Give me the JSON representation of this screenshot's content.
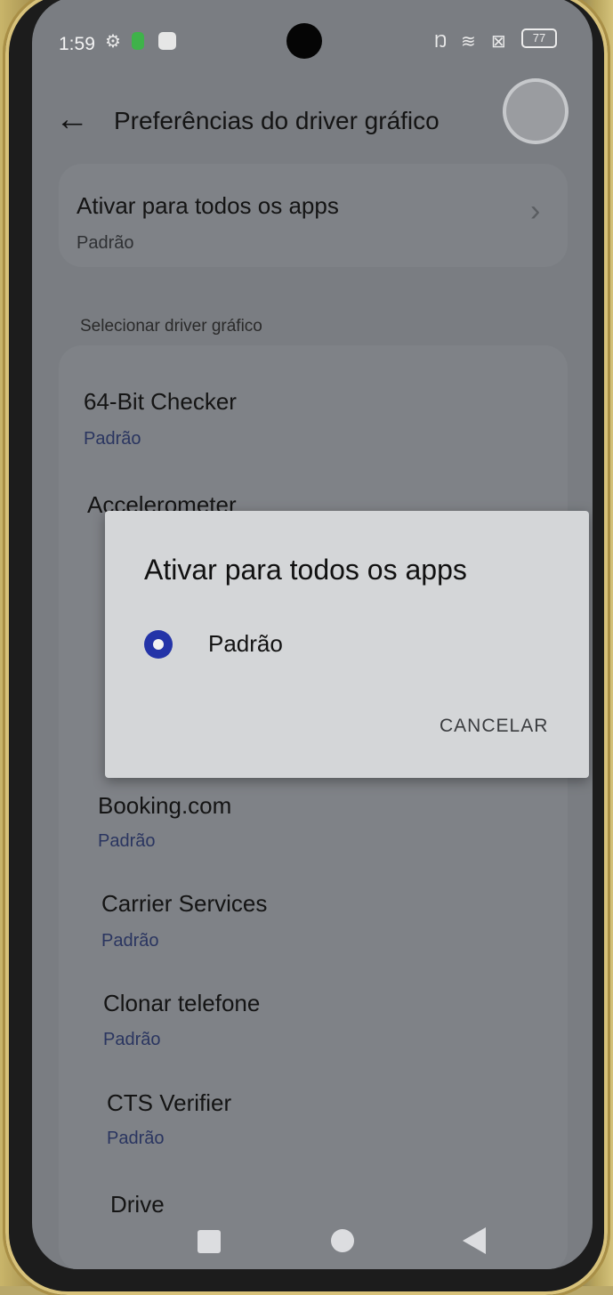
{
  "status_bar": {
    "time": "1:59",
    "battery": "77"
  },
  "header": {
    "title": "Preferências do driver gráfico"
  },
  "top_setting": {
    "title": "Ativar para todos os apps",
    "value": "Padrão"
  },
  "section_label": "Selecionar driver gráfico",
  "apps": [
    {
      "name": "64-Bit Checker",
      "value": "Padrão"
    },
    {
      "name": "Accelerometer",
      "value": ""
    },
    {
      "name": "Booking.com",
      "value": "Padrão"
    },
    {
      "name": "Carrier Services",
      "value": "Padrão"
    },
    {
      "name": "Clonar telefone",
      "value": "Padrão"
    },
    {
      "name": "CTS Verifier",
      "value": "Padrão"
    },
    {
      "name": "Drive",
      "value": ""
    }
  ],
  "dialog": {
    "title": "Ativar para todos os apps",
    "option": "Padrão",
    "cancel_label": "CANCELAR"
  },
  "colors": {
    "accent": "#2434a8",
    "subtitle_blue": "#2a3560"
  }
}
